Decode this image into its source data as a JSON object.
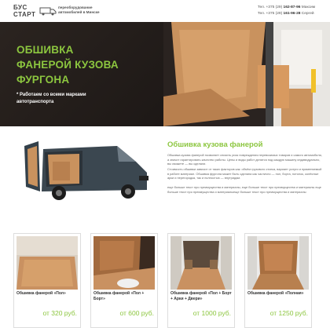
{
  "header": {
    "logo_line1": "БУС",
    "logo_line2": "СТАРТ",
    "tagline_line1": "переоборудование",
    "tagline_line2": "автомобилей в Минске",
    "phone1_prefix": "Тел. +375 (29)",
    "phone1_number": "162-87-96",
    "phone1_name": "Максим",
    "phone2_prefix": "Тел. +375 (29)",
    "phone2_number": "161-96-28",
    "phone2_name": "Сергей"
  },
  "hero": {
    "title_line1": "ОБШИВКА",
    "title_line2": "ФАНЕРОЙ КУЗОВА",
    "title_line3": "ФУРГОНА",
    "note": "* Работаем со всеми марками автотранспорта"
  },
  "section": {
    "title": "Обшивка кузова фанерой",
    "p1": "Обшивка кузова фанерой позволяет снизить риск повреждения перевозимых товаров и самого автомобиля, а значит гарантировать качество работы. Цены и виды работ делятся под каждую машину индивидуально, вы сможете — вы сделали.",
    "p2": "Стоимость обшивки зависит от таких факторов как: объём грузового отсека, вариант услуги и применяемый в работе материал. Обшивка фургона может быть сделана как частично — пол, борта, потолок, колёсные арки и перегородка, так и полностью — внутридам.",
    "p3": "еще больше текст про преимущества и материалы, еще больше текст про преимущества и материалы еще больше текст про преимущества и материалыеще больше текст про преимущества и материалы"
  },
  "products": [
    {
      "name": "Обшивка фанерой «Пол»",
      "price": "от 320 руб."
    },
    {
      "name": "Обшивка фанерой «Пол + Борт»",
      "price": "от 600 руб."
    },
    {
      "name": "Обшивка фанерой «Пол + Борт + Арки + Двери»",
      "price": "от 1000 руб."
    },
    {
      "name": "Обшивка фанерой «Полная»",
      "price": "от 1250 руб."
    }
  ],
  "colors": {
    "accent": "#8cc63f",
    "hero_bg": "#241e1b",
    "plywood": "#c9925e"
  }
}
